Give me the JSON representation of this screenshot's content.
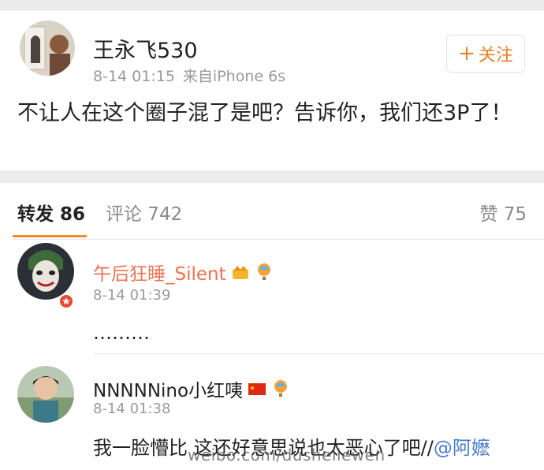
{
  "post": {
    "author": "王永飞530",
    "time": "8-14 01:15",
    "source": "来自iPhone 6s",
    "follow_label": "关注",
    "text": "不让人在这个圈子混了是吧？告诉你，我们还3P了！"
  },
  "tabs": {
    "repost": "转发 86",
    "comment": "评论 742",
    "like": "赞 75"
  },
  "comments": [
    {
      "name": "午后狂睡_Silent",
      "time": "8-14 01:39",
      "text": "………"
    },
    {
      "name": "NNNNNino小红咦",
      "time": "8-14 01:38",
      "text": "我一脸懵比 这还好意思说也太恶心了吧//",
      "mention": "@阿嬷"
    }
  ],
  "watermark": "weibo.com/dusheliewen"
}
